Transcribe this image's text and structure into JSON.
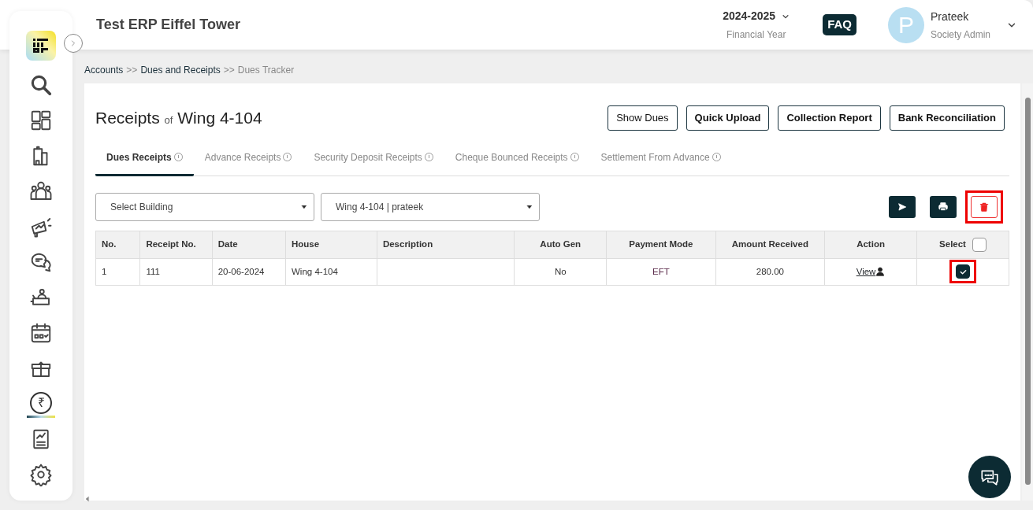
{
  "header": {
    "title": "Test ERP Eiffel Tower",
    "year": {
      "value": "2024-2025",
      "label": "Financial Year"
    },
    "faq": "FAQ",
    "user": {
      "initial": "P",
      "name": "Prateek",
      "role": "Society Admin"
    }
  },
  "sidebar": {
    "items": [
      {
        "selected": false
      },
      {
        "selected": false
      },
      {
        "selected": false
      },
      {
        "selected": false
      },
      {
        "selected": false
      },
      {
        "selected": false
      },
      {
        "selected": false
      },
      {
        "selected": false
      },
      {
        "selected": false
      },
      {
        "selected": true,
        "glyph": "₹"
      },
      {
        "selected": false
      },
      {
        "selected": false
      }
    ]
  },
  "breadcrumb": [
    {
      "label": "Accounts",
      "current": false
    },
    {
      "label": ">>",
      "kind": "sep"
    },
    {
      "label": "Dues and Receipts",
      "current": false
    },
    {
      "label": ">>",
      "kind": "sep"
    },
    {
      "label": "Dues Tracker",
      "current": true
    }
  ],
  "page": {
    "title": "Receipts",
    "title_of": "of",
    "title_subject": "Wing 4-104"
  },
  "buttons": [
    {
      "label": "Show Dues",
      "kind": "plain"
    },
    {
      "label": "Quick Upload",
      "kind": "bold"
    },
    {
      "label": "Collection Report",
      "kind": "bold"
    },
    {
      "label": "Bank Reconciliation",
      "kind": "bold"
    }
  ],
  "tabs": [
    {
      "label": "Dues Receipts",
      "selected": true
    },
    {
      "label": "Advance Receipts",
      "selected": false
    },
    {
      "label": "Security Deposit Receipts",
      "selected": false
    },
    {
      "label": "Cheque Bounced Receipts",
      "selected": false
    },
    {
      "label": "Settlement From Advance",
      "selected": false
    }
  ],
  "filters": [
    {
      "value": "Select Building"
    },
    {
      "value": "Wing 4-104 | prateek"
    }
  ],
  "actions": [
    {
      "kind": "send",
      "highlighted": false
    },
    {
      "kind": "print",
      "highlighted": false
    },
    {
      "kind": "delete",
      "highlighted": true
    }
  ],
  "table": {
    "columns": [
      "No.",
      "Receipt No.",
      "Date",
      "House",
      "Description",
      "Auto Gen",
      "Payment Mode",
      "Amount Received",
      "Action",
      "Select"
    ],
    "select_all_checked": false,
    "rows": [
      {
        "no": "1",
        "receipt_no": "111",
        "date": "20-06-2024",
        "house": "Wing 4-104",
        "auto_gen": "No",
        "payment_mode": "EFT",
        "amount": "280.00",
        "action": "View",
        "checked": true,
        "highlighted": true
      }
    ]
  }
}
